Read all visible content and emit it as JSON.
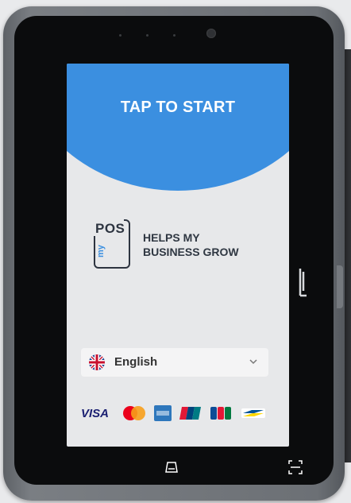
{
  "screen": {
    "tap_label": "TAP TO START",
    "brand": {
      "pos": "POS",
      "my": "my",
      "slogan_line1": "HELPS MY",
      "slogan_line2": "BUSINESS GROW"
    },
    "language": {
      "selected": "English"
    },
    "payment_methods": [
      "VISA",
      "mastercard-icon",
      "amex-icon",
      "unionpay-icon",
      "jcb-icon",
      "bancontact-icon"
    ]
  },
  "colors": {
    "accent": "#3b8fe0",
    "screen_bg": "#e7e8ea",
    "bezel": "#0b0c0d"
  }
}
